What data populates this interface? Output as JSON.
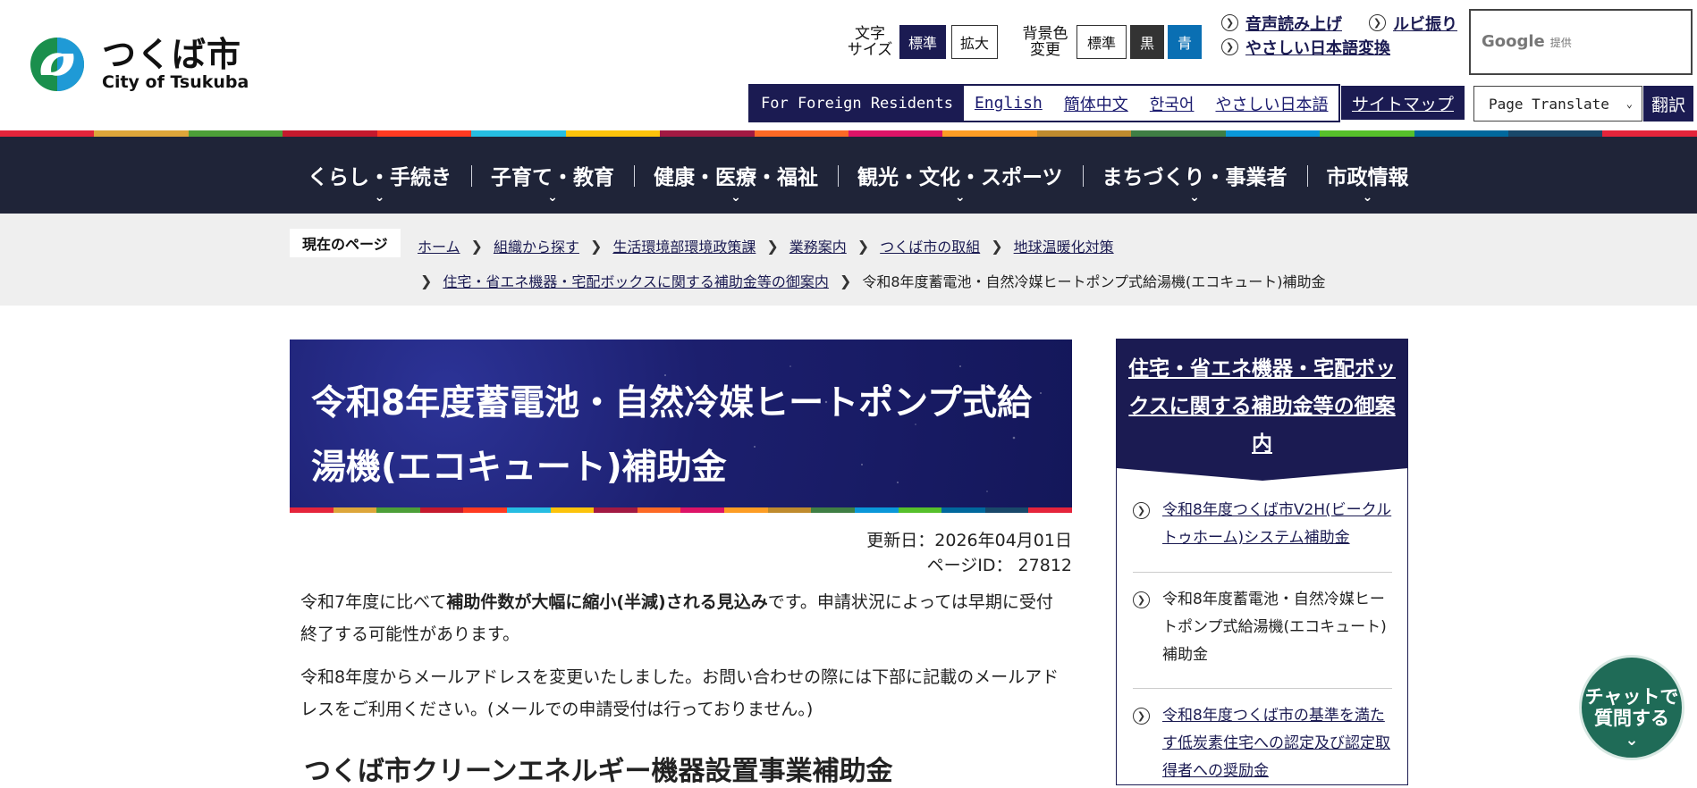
{
  "header": {
    "logo": {
      "ja": "つくば市",
      "en": "City of Tsukuba"
    },
    "font_size": {
      "label": "文字\nサイズ",
      "options": [
        "標準",
        "拡大"
      ],
      "selected": "標準"
    },
    "bg_color": {
      "label": "背景色\n変更",
      "options": [
        "標準",
        "黒",
        "青"
      ]
    },
    "util_links": [
      "音声読み上げ",
      "ルビ振り",
      "やさしい日本語変換"
    ],
    "google": {
      "brand": "Google",
      "suffix": "提供"
    },
    "foreign": {
      "label": "For Foreign Residents",
      "languages": [
        "English",
        "簡体中文",
        "한국어",
        "やさしい日本語"
      ]
    },
    "sitemap": "サイトマップ",
    "translate": {
      "select": "Page Translate",
      "button": "翻訳"
    }
  },
  "stripe_colors": [
    "#e5243b",
    "#dda63a",
    "#4c9f38",
    "#c5192d",
    "#ff3a21",
    "#26bde2",
    "#fcc30b",
    "#a21942",
    "#fd6925",
    "#dd1367",
    "#fd9d24",
    "#bf8b2e",
    "#3f7e44",
    "#0a97d9",
    "#56c02b",
    "#00689d",
    "#19486a",
    "#e5243b"
  ],
  "nav": [
    "くらし・手続き",
    "子育て・教育",
    "健康・医療・福祉",
    "観光・文化・スポーツ",
    "まちづくり・事業者",
    "市政情報"
  ],
  "breadcrumb": {
    "here_label": "現在のページ",
    "row1": [
      "ホーム",
      "組織から探す",
      "生活環境部環境政策課",
      "業務案内",
      "つくば市の取組",
      "地球温暖化対策"
    ],
    "row2_link": "住宅・省エネ機器・宅配ボックスに関する補助金等の御案内",
    "current": "令和8年度蓄電池・自然冷媒ヒートポンプ式給湯機(エコキュート)補助金"
  },
  "main": {
    "title": "令和8年度蓄電池・自然冷媒ヒートポンプ式給湯機(エコキュート)補助金",
    "updated": "更新日：2026年04月01日",
    "page_id": "ページID： 27812",
    "para1_pre": "令和7年度に比べて",
    "para1_bold": "補助件数が大幅に縮小(半減)される見込み",
    "para1_post": "です。申請状況によっては早期に受付終了する可能性があります。",
    "para2": "令和8年度からメールアドレスを変更いたしました。お問い合わせの際には下部に記載のメールアドレスをご利用ください。(メールでの申請受付は行っておりません。)",
    "section_heading": "つくば市クリーンエネルギー機器設置事業補助金"
  },
  "sidebar": {
    "heading": "住宅・省エネ機器・宅配ボックスに関する補助金等の御案内",
    "items": [
      {
        "label": "令和8年度つくば市V2H(ビークルトゥホーム)システム補助金",
        "link": true
      },
      {
        "label": "令和8年度蓄電池・自然冷媒ヒートポンプ式給湯機(エコキュート)補助金",
        "link": false
      },
      {
        "label": "令和8年度つくば市の基準を満たす低炭素住宅への認定及び認定取得者への奨励金",
        "link": true
      }
    ]
  },
  "chat": {
    "label_line1": "チャットで",
    "label_line2": "質問する"
  }
}
